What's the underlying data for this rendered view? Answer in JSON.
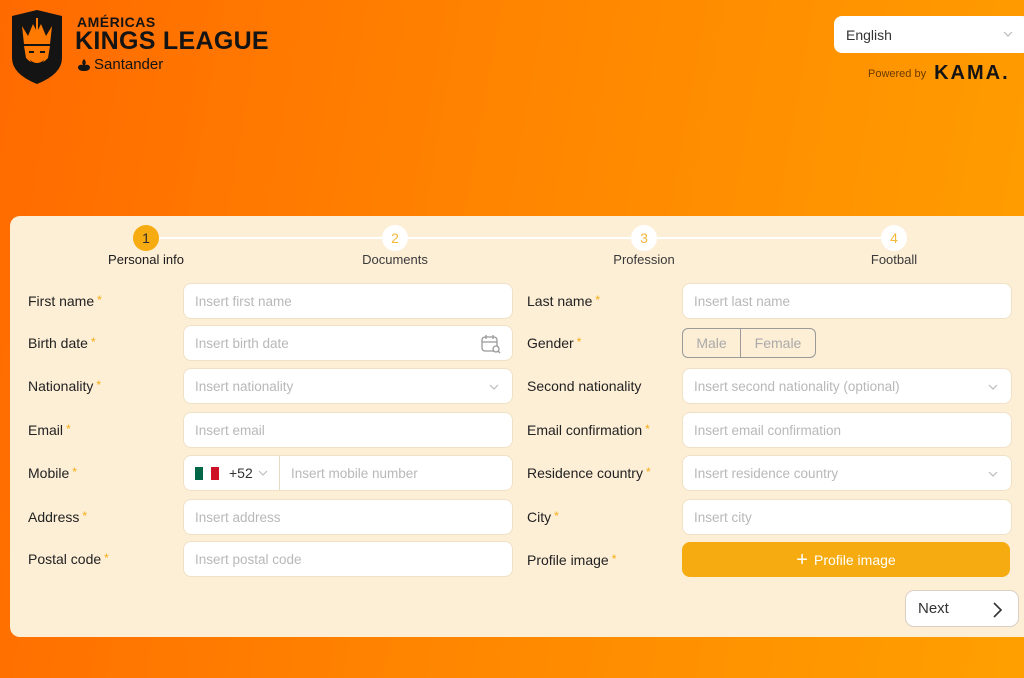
{
  "header": {
    "brand_sub": "AMÉRICAS",
    "brand_title": "KINGS LEAGUE",
    "sponsor": "Santander",
    "language": "English",
    "powered_by": "Powered by",
    "powered_brand": "KAMA."
  },
  "stepper": {
    "steps": [
      {
        "number": "1",
        "label": "Personal info",
        "active": true
      },
      {
        "number": "2",
        "label": "Documents",
        "active": false
      },
      {
        "number": "3",
        "label": "Profession",
        "active": false
      },
      {
        "number": "4",
        "label": "Football",
        "active": false
      }
    ]
  },
  "form": {
    "required_mark": "*",
    "first_name": {
      "label": "First name",
      "placeholder": "Insert first name",
      "value": ""
    },
    "last_name": {
      "label": "Last name",
      "placeholder": "Insert last name",
      "value": ""
    },
    "birth_date": {
      "label": "Birth date",
      "placeholder": "Insert birth date",
      "value": ""
    },
    "gender": {
      "label": "Gender",
      "options": [
        "Male",
        "Female"
      ],
      "selected": ""
    },
    "nationality": {
      "label": "Nationality",
      "placeholder": "Insert nationality",
      "value": ""
    },
    "second_nationality": {
      "label": "Second nationality",
      "placeholder": "Insert second nationality (optional)",
      "value": ""
    },
    "email": {
      "label": "Email",
      "placeholder": "Insert email",
      "value": ""
    },
    "email_confirmation": {
      "label": "Email confirmation",
      "placeholder": "Insert email confirmation",
      "value": ""
    },
    "mobile": {
      "label": "Mobile",
      "country_code": "+52",
      "country_flag": "mexico-flag",
      "placeholder": "Insert mobile number",
      "value": ""
    },
    "residence_country": {
      "label": "Residence country",
      "placeholder": "Insert residence country",
      "value": ""
    },
    "address": {
      "label": "Address",
      "placeholder": "Insert address",
      "value": ""
    },
    "city": {
      "label": "City",
      "placeholder": "Insert city",
      "value": ""
    },
    "postal_code": {
      "label": "Postal code",
      "placeholder": "Insert postal code",
      "value": ""
    },
    "profile_image": {
      "label": "Profile image",
      "button_label": "Profile image"
    }
  },
  "actions": {
    "next_label": "Next"
  },
  "colors": {
    "accent": "#f6ac11",
    "card_bg": "#fdeed6",
    "bg_start": "#ff6a00",
    "bg_end": "#ffa000"
  }
}
